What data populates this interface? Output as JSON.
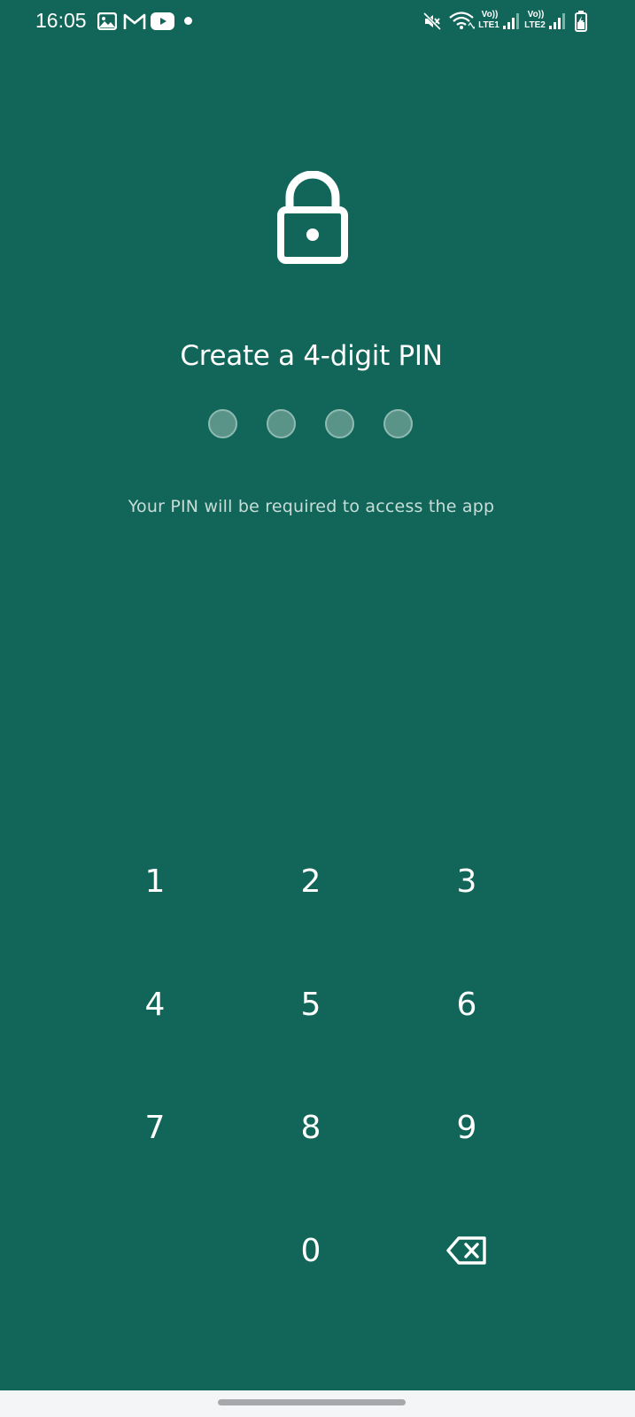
{
  "status_bar": {
    "time": "16:05",
    "notification_icons": [
      "gallery-icon",
      "gmail-icon",
      "youtube-icon",
      "more-dot-icon"
    ],
    "system_icons": [
      "mute-icon",
      "wifi-icon",
      "volte-sim1-icon",
      "signal-sim1-icon",
      "volte-sim2-icon",
      "signal-sim2-icon",
      "battery-charging-icon"
    ],
    "sim1_top": "Vo))",
    "sim1_bottom": "LTE1",
    "sim2_top": "Vo))",
    "sim2_bottom": "LTE2"
  },
  "pin_setup": {
    "icon": "lock-icon",
    "title": "Create a 4-digit PIN",
    "pin_length": 4,
    "digits_entered": 0,
    "hint": "Your PIN will be required to access the app"
  },
  "keypad": {
    "keys": [
      "1",
      "2",
      "3",
      "4",
      "5",
      "6",
      "7",
      "8",
      "9",
      "0"
    ],
    "backspace_icon": "backspace-icon"
  },
  "colors": {
    "background": "#116659",
    "text": "#ffffff",
    "pin_dot_fill": "#5a9489",
    "nav_bar": "#f4f5f7"
  }
}
